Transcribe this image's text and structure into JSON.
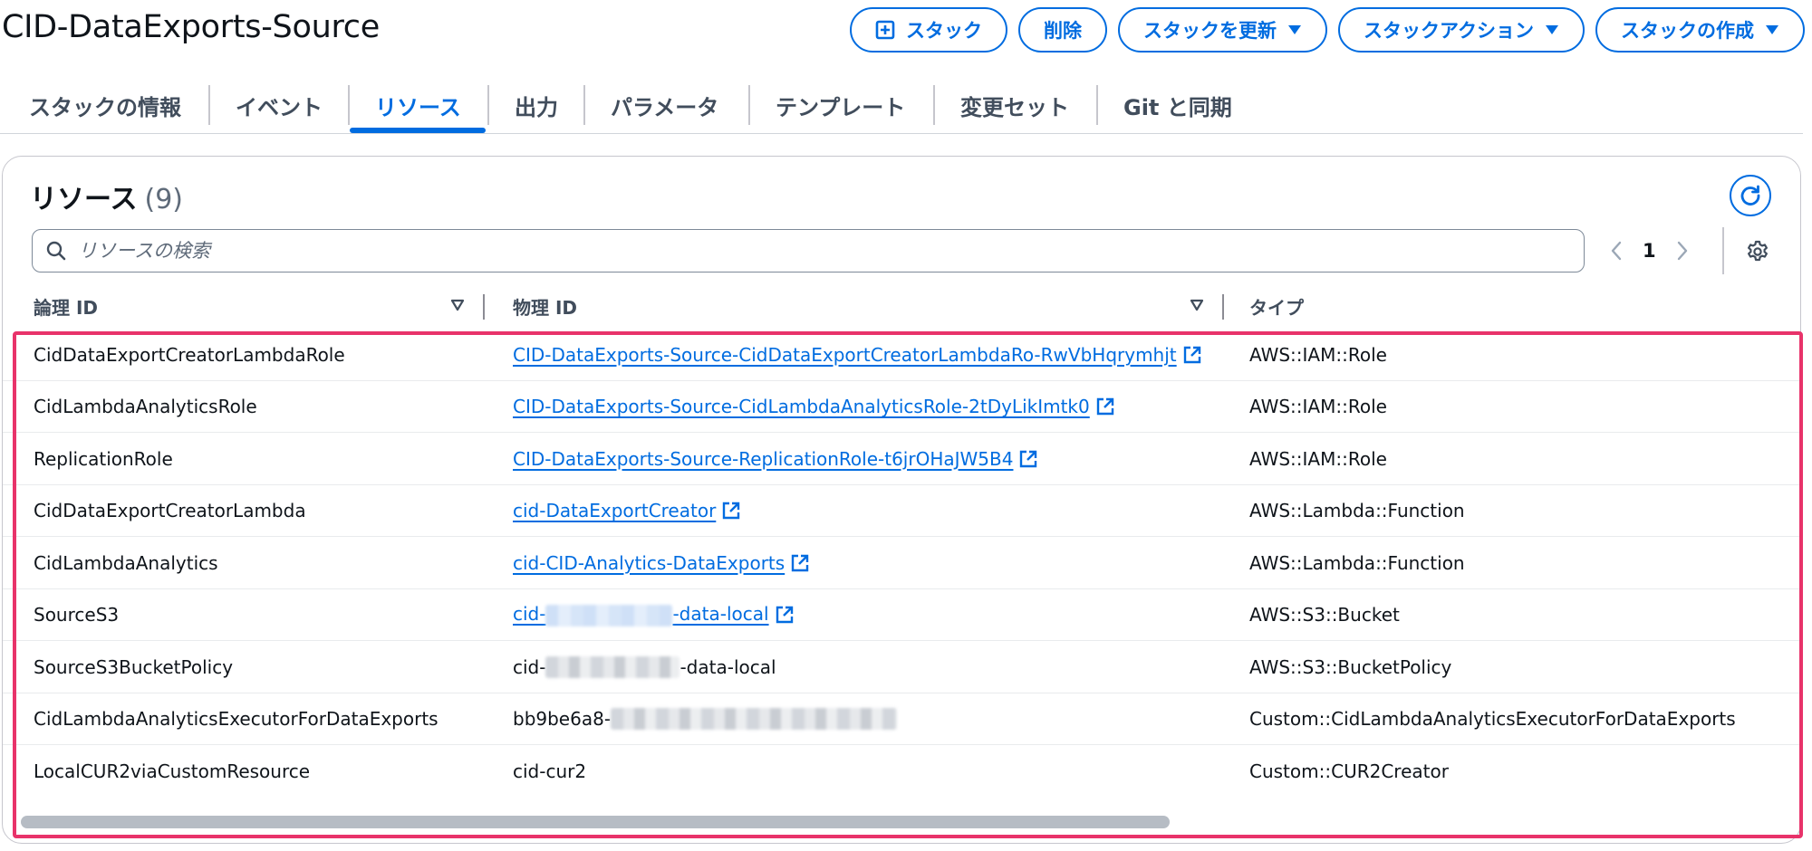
{
  "header": {
    "title": "CID-DataExports-Source",
    "buttons": {
      "stack": "スタック",
      "delete": "削除",
      "update": "スタックを更新",
      "actions": "スタックアクション",
      "create": "スタックの作成"
    }
  },
  "tabs": [
    {
      "label": "スタックの情報"
    },
    {
      "label": "イベント"
    },
    {
      "label": "リソース",
      "active": true
    },
    {
      "label": "出力"
    },
    {
      "label": "パラメータ"
    },
    {
      "label": "テンプレート"
    },
    {
      "label": "変更セット"
    },
    {
      "label": "Git と同期"
    }
  ],
  "resources": {
    "title": "リソース",
    "count": "(9)",
    "search_placeholder": "リソースの検索",
    "page": "1",
    "columns": {
      "logical_id": "論理 ID",
      "physical_id": "物理 ID",
      "type": "タイプ"
    },
    "rows": [
      {
        "logical_id": "CidDataExportCreatorLambdaRole",
        "physical_id": "CID-DataExports-Source-CidDataExportCreatorLambdaRo-RwVbHqrymhjt",
        "type": "AWS::IAM::Role"
      },
      {
        "logical_id": "CidLambdaAnalyticsRole",
        "physical_id": "CID-DataExports-Source-CidLambdaAnalyticsRole-2tDyLikImtk0",
        "type": "AWS::IAM::Role"
      },
      {
        "logical_id": "ReplicationRole",
        "physical_id": "CID-DataExports-Source-ReplicationRole-t6jrOHaJW5B4",
        "type": "AWS::IAM::Role"
      },
      {
        "logical_id": "CidDataExportCreatorLambda",
        "physical_id": "cid-DataExportCreator",
        "type": "AWS::Lambda::Function"
      },
      {
        "logical_id": "CidLambdaAnalytics",
        "physical_id": "cid-CID-Analytics-DataExports",
        "type": "AWS::Lambda::Function"
      },
      {
        "logical_id": "SourceS3",
        "physical_id_prefix": "cid-",
        "physical_id_suffix": "-data-local",
        "type": "AWS::S3::Bucket"
      },
      {
        "logical_id": "SourceS3BucketPolicy",
        "physical_id_prefix": "cid-",
        "physical_id_suffix": "-data-local",
        "type": "AWS::S3::BucketPolicy"
      },
      {
        "logical_id": "CidLambdaAnalyticsExecutorForDataExports",
        "physical_id_prefix": "bb9be6a8-",
        "type": "Custom::CidLambdaAnalyticsExecutorForDataExports"
      },
      {
        "logical_id": "LocalCUR2viaCustomResource",
        "physical_id": "cid-cur2",
        "type": "Custom::CUR2Creator"
      }
    ]
  }
}
